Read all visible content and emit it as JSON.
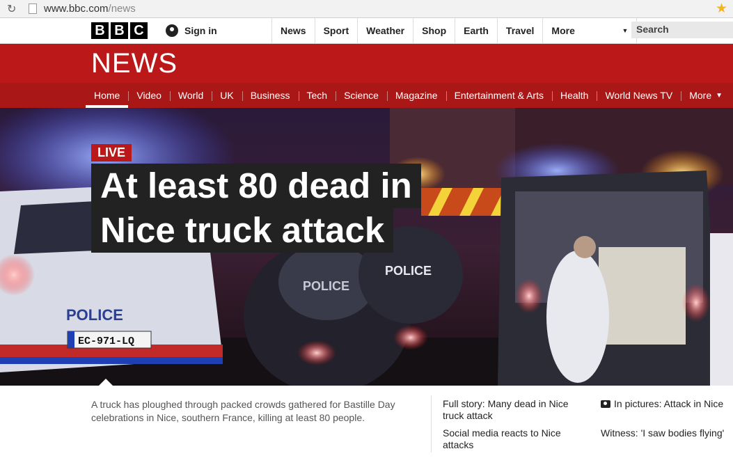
{
  "browser": {
    "url_host": "www.bbc.com",
    "url_path": "/news"
  },
  "header": {
    "logo_letters": [
      "B",
      "B",
      "C"
    ],
    "sign_in": "Sign in",
    "nav": [
      "News",
      "Sport",
      "Weather",
      "Shop",
      "Earth",
      "Travel"
    ],
    "more": "More",
    "search_placeholder": "Search"
  },
  "newsband": {
    "title": "NEWS"
  },
  "sections": [
    "Home",
    "Video",
    "World",
    "UK",
    "Business",
    "Tech",
    "Science",
    "Magazine",
    "Entertainment & Arts",
    "Health",
    "World News TV",
    "More"
  ],
  "hero": {
    "badge": "LIVE",
    "headline_line1": "At least 80 dead in",
    "headline_line2": "Nice truck attack",
    "image_text": {
      "police_car": "POLICE",
      "plate": "EC-971-LQ",
      "police_moto": "POLICE",
      "police_vest": "POLICE"
    }
  },
  "summary": "A truck has ploughed through packed crowds gathered for Bastille Day celebrations in Nice, southern France, killing at least 80 people.",
  "links": [
    "Full story: Many dead in Nice truck attack",
    "Social media reacts to Nice attacks",
    "In pictures: Attack in Nice",
    "Witness: 'I saw bodies flying'"
  ],
  "colors": {
    "brand_red": "#bb1919",
    "nav_red": "#a91717"
  }
}
